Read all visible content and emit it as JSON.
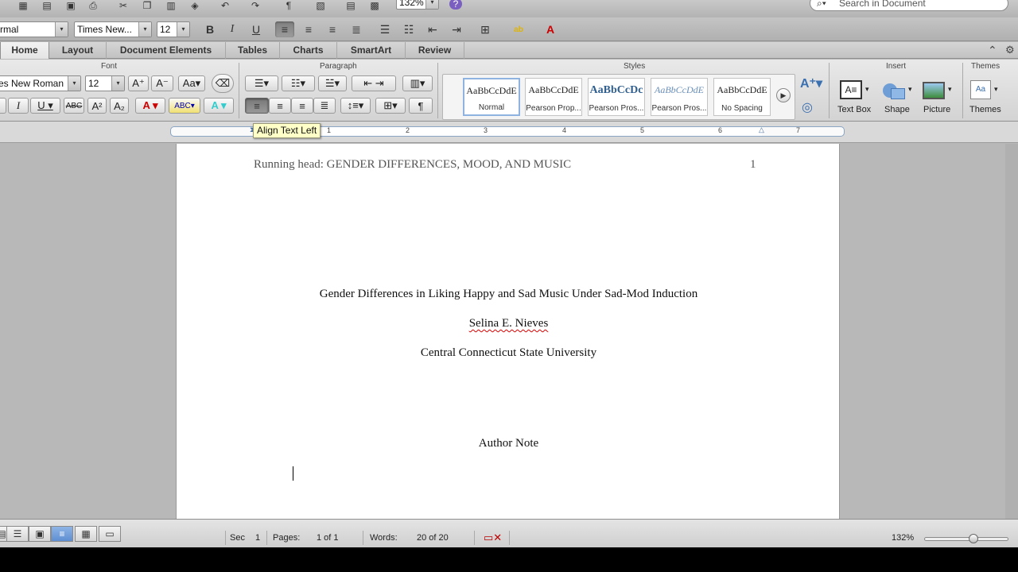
{
  "toolbar1": {
    "zoom_value": "132%",
    "search_placeholder": "Search in Document"
  },
  "toolbar2": {
    "style_value": "rmal",
    "font_value": "Times New...",
    "size_value": "12",
    "bold": "B",
    "italic": "I",
    "underline": "U"
  },
  "tabs": [
    {
      "label": "Home"
    },
    {
      "label": "Layout"
    },
    {
      "label": "Document Elements"
    },
    {
      "label": "Tables"
    },
    {
      "label": "Charts"
    },
    {
      "label": "SmartArt"
    },
    {
      "label": "Review"
    }
  ],
  "ribbon": {
    "groups": {
      "font": "Font",
      "paragraph": "Paragraph",
      "styles": "Styles",
      "insert": "Insert",
      "themes": "Themes"
    },
    "font_name": "es New Roman",
    "font_size": "12",
    "styles": [
      {
        "sample": "AaBbCcDdE",
        "label": "Normal"
      },
      {
        "sample": "AaBbCcDdE",
        "label": "Pearson Prop..."
      },
      {
        "sample": "AaBbCcDc",
        "label": "Pearson Pros..."
      },
      {
        "sample": "AaBbCcDdE",
        "label": "Pearson Pros..."
      },
      {
        "sample": "AaBbCcDdE",
        "label": "No Spacing"
      }
    ],
    "insert_items": {
      "text_box": "Text Box",
      "shape": "Shape",
      "picture": "Picture",
      "themes": "Themes"
    }
  },
  "ruler": {
    "numbers": [
      "1",
      "2",
      "3",
      "4",
      "5",
      "6",
      "7"
    ],
    "tooltip": "Align Text Left"
  },
  "document": {
    "header_text": "Running head: GENDER DIFFERENCES, MOOD, AND MUSIC",
    "page_number": "1",
    "title": "Gender Differences in Liking Happy and Sad Music Under Sad-Mod Induction",
    "author": "Selina E. Nieves",
    "affiliation": "Central Connecticut State University",
    "author_note": "Author Note"
  },
  "statusbar": {
    "sec_label": "Sec",
    "sec_value": "1",
    "pages_label": "Pages:",
    "pages_value": "1 of 1",
    "words_label": "Words:",
    "words_value": "20 of 20",
    "zoom": "132%",
    "zoom_level": 0.6
  }
}
